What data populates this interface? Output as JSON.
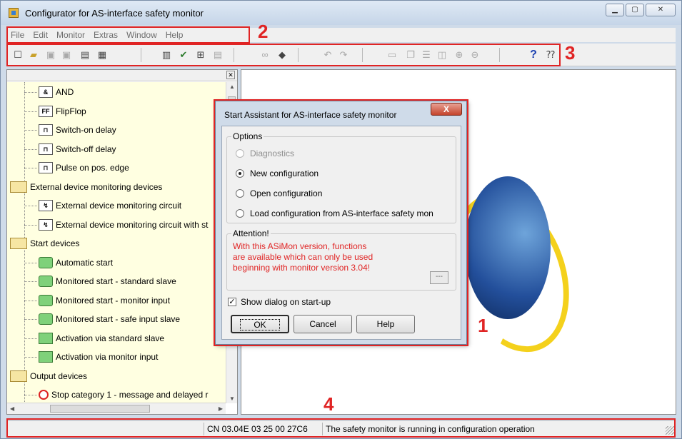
{
  "window": {
    "title": "Configurator for AS-interface safety monitor"
  },
  "menu": [
    "File",
    "Edit",
    "Monitor",
    "Extras",
    "Window",
    "Help"
  ],
  "callouts": {
    "dialog": "1",
    "menu": "2",
    "toolbar": "3",
    "status": "4"
  },
  "tree": {
    "items": [
      {
        "label": "AND",
        "icon": "and-gate-icon",
        "glyph": "&",
        "level": 2
      },
      {
        "label": "FlipFlop",
        "icon": "flipflop-icon",
        "glyph": "FF",
        "level": 2
      },
      {
        "label": "Switch-on delay",
        "icon": "switch-on-delay-icon",
        "glyph": "⊓",
        "level": 2
      },
      {
        "label": "Switch-off delay",
        "icon": "switch-off-delay-icon",
        "glyph": "⊓",
        "level": 2
      },
      {
        "label": "Pulse on pos. edge",
        "icon": "pulse-icon",
        "glyph": "⊓",
        "level": 2
      },
      {
        "label": "External device monitoring devices",
        "icon": "folder-icon",
        "level": 1
      },
      {
        "label": "External device monitoring circuit",
        "icon": "edm-icon",
        "glyph": "↯",
        "level": 2
      },
      {
        "label": "External device monitoring circuit with st",
        "icon": "edm-icon",
        "glyph": "↯",
        "level": 2
      },
      {
        "label": "Start devices",
        "icon": "folder-icon",
        "level": 1
      },
      {
        "label": "Automatic start",
        "icon": "automatic-start-icon",
        "level": 2
      },
      {
        "label": "Monitored start - standard slave",
        "icon": "start-icon",
        "level": 2
      },
      {
        "label": "Monitored start - monitor input",
        "icon": "start-icon",
        "level": 2
      },
      {
        "label": "Monitored start - safe input slave",
        "icon": "start-icon",
        "level": 2
      },
      {
        "label": "Activation via standard slave",
        "icon": "activation-icon",
        "level": 2
      },
      {
        "label": "Activation via monitor input",
        "icon": "activation-icon",
        "level": 2
      },
      {
        "label": "Output devices",
        "icon": "folder-icon",
        "level": 1
      },
      {
        "label": "Stop category 1 - message and delayed r",
        "icon": "clock-icon",
        "level": 2
      }
    ]
  },
  "dialog": {
    "title": "Start Assistant for AS-interface safety monitor",
    "close": "X",
    "options_label": "Options",
    "options": [
      {
        "label": "Diagnostics",
        "disabled": true,
        "selected": false
      },
      {
        "label": "New configuration",
        "disabled": false,
        "selected": true
      },
      {
        "label": "Open configuration",
        "disabled": false,
        "selected": false
      },
      {
        "label": "Load configuration from AS-interface safety mon",
        "disabled": false,
        "selected": false
      }
    ],
    "attention_label": "Attention!",
    "attention_lines": [
      "With this ASiMon version, functions",
      "are available which can only be used",
      "beginning with monitor version 3.04!"
    ],
    "dots": "---",
    "show_on_startup": "Show dialog on start-up",
    "show_on_startup_checked": true,
    "buttons": {
      "ok": "OK",
      "cancel": "Cancel",
      "help": "Help"
    }
  },
  "status": {
    "code": "CN 03.04E 03 25 00 27C6",
    "message": "The safety monitor is running in configuration operation"
  },
  "colors": {
    "highlight": "#e02424",
    "tree_bg": "#ffffe1",
    "window": "#cfdbe9"
  }
}
